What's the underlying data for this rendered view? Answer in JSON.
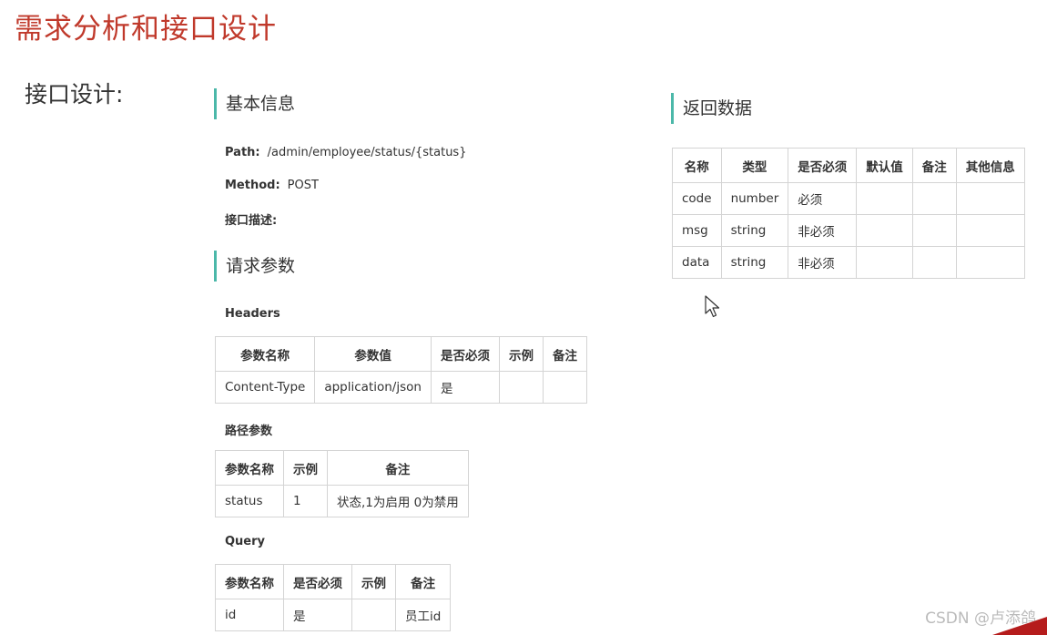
{
  "slide": {
    "title": "需求分析和接口设计",
    "section_label": "接口设计:"
  },
  "basic_info": {
    "heading": "基本信息",
    "path_label": "Path:",
    "path_value": "/admin/employee/status/{status}",
    "method_label": "Method:",
    "method_value": "POST",
    "desc_label": "接口描述:"
  },
  "request_params": {
    "heading": "请求参数",
    "headers": {
      "label": "Headers",
      "columns": [
        "参数名称",
        "参数值",
        "是否必须",
        "示例",
        "备注"
      ],
      "rows": [
        [
          "Content-Type",
          "application/json",
          "是",
          "",
          ""
        ]
      ]
    },
    "path_params": {
      "label": "路径参数",
      "columns": [
        "参数名称",
        "示例",
        "备注"
      ],
      "rows": [
        [
          "status",
          "1",
          "状态,1为启用 0为禁用"
        ]
      ]
    },
    "query": {
      "label": "Query",
      "columns": [
        "参数名称",
        "是否必须",
        "示例",
        "备注"
      ],
      "rows": [
        [
          "id",
          "是",
          "",
          "员工id"
        ]
      ]
    }
  },
  "response": {
    "heading": "返回数据",
    "columns": [
      "名称",
      "类型",
      "是否必须",
      "默认值",
      "备注",
      "其他信息"
    ],
    "rows": [
      [
        "code",
        "number",
        "必须",
        "",
        "",
        ""
      ],
      [
        "msg",
        "string",
        "非必须",
        "",
        "",
        ""
      ],
      [
        "data",
        "string",
        "非必须",
        "",
        "",
        ""
      ]
    ]
  },
  "watermark": "CSDN @卢添鸽",
  "icons": {
    "cursor": "mouse-pointer-icon"
  }
}
